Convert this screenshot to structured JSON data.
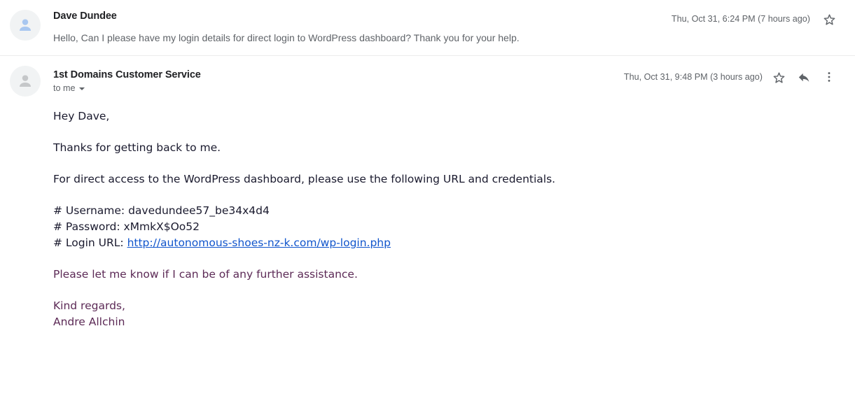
{
  "thread": {
    "messages": [
      {
        "id": "collapsed",
        "sender": "Dave Dundee",
        "avatar_icon": "person-avatar-icon",
        "avatar_variant": "blue",
        "timestamp": "Thu, Oct 31, 6:24 PM (7 hours ago)",
        "snippet": "Hello, Can I please have my login details for direct login to WordPress dashboard? Thank you for your help.",
        "star_icon": "star-outline-icon"
      },
      {
        "id": "expanded",
        "sender": "1st Domains Customer Service",
        "avatar_icon": "person-avatar-icon",
        "avatar_variant": "gray",
        "recipient_label": "to me",
        "timestamp": "Thu, Oct 31, 9:48 PM (3 hours ago)",
        "star_icon": "star-outline-icon",
        "reply_icon": "reply-arrow-icon",
        "more_icon": "more-vertical-icon",
        "body": {
          "greeting": "Hey Dave,",
          "thanks": "Thanks for getting back to me.",
          "intro": "For direct access to the WordPress dashboard, please use the following URL and credentials.",
          "username_line": "# Username: davedundee57_be34x4d4",
          "password_line": "# Password: xMmkX$Oo52",
          "login_url_label": "# Login URL: ",
          "login_url": "http://autonomous-shoes-nz-k.com/wp-login.php",
          "closing": "Please let me know if I can be of any further assistance.",
          "signoff": "Kind regards,",
          "signature_name": "Andre Allchin"
        }
      }
    ]
  },
  "colors": {
    "link": "#1155cc",
    "signature": "#5c2a56",
    "body_text": "#1a1a2e",
    "muted": "#5f6368",
    "avatar_blue": "#a8c7f0",
    "avatar_gray": "#c5c7c9",
    "divider": "#ebebeb"
  }
}
